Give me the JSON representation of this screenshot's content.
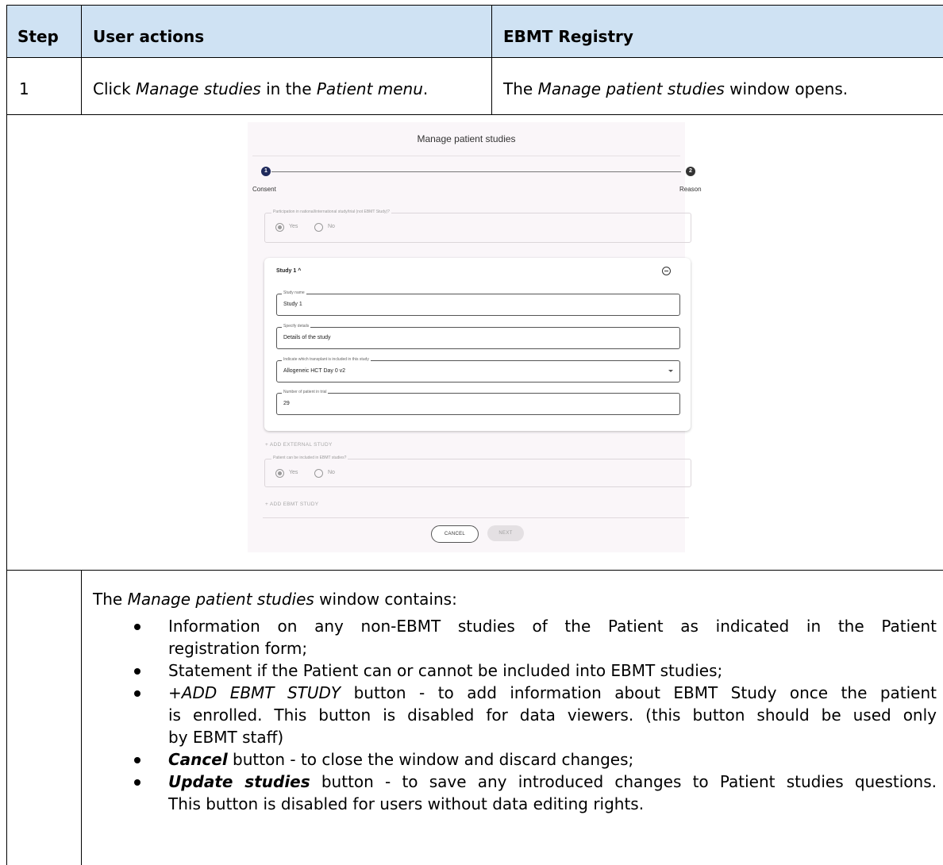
{
  "table": {
    "headers": [
      "Step",
      "User actions",
      "EBMT Registry"
    ],
    "row1": {
      "step": "1",
      "action": {
        "pre": "Click ",
        "em1": "Manage studies",
        "mid": " in the ",
        "em2": "Patient menu",
        "post": "."
      },
      "registry": {
        "pre": "The ",
        "em": "Manage patient studies",
        "post": " window opens."
      }
    }
  },
  "screenshot": {
    "title": "Manage patient studies",
    "steps": [
      {
        "num": "1",
        "label": "Consent"
      },
      {
        "num": "2",
        "label": "Reason"
      }
    ],
    "participation_legend": "Participation in national/international study/trial (not EBMT Study)?",
    "radio_yes": "Yes",
    "radio_no": "No",
    "study_card": {
      "title": "Study 1 ^",
      "fields": [
        {
          "label": "Study name",
          "value": "Study 1"
        },
        {
          "label": "Specify details",
          "value": "Details of the study"
        },
        {
          "label": "Indicate which transplant is included in this study",
          "value": "Allogeneic HCT Day 0 v2"
        },
        {
          "label": "Number of patient in trial",
          "value": "29"
        }
      ]
    },
    "add_external": "+ ADD EXTERNAL STUDY",
    "ebmt_legend": "Patient can be included in EBMT studies?",
    "add_ebmt": "+ ADD EBMT STUDY",
    "cancel": "CANCEL",
    "next": "NEXT"
  },
  "description": {
    "intro": {
      "pre": "The ",
      "em": "Manage patient studies",
      "post": " window contains:"
    },
    "b1": {
      "line1": "Information on any non-EBMT studies of the Patient as indicated in the Patient",
      "line2": "registration form;"
    },
    "b2": {
      "line1": "Statement if the Patient can or cannot be included into EBMT studies;"
    },
    "b3": {
      "em": "+ADD EBMT STUDY",
      "line1_rest": " button - to add information about EBMT Study once the patient",
      "line2": "is enrolled. This button is disabled for data viewers. (this button should be used only",
      "line3": "by EBMT staff)"
    },
    "b4": {
      "strong": "Cancel",
      "rest": " button - to close the window and discard changes;"
    },
    "b5": {
      "strong": "Update studies",
      "line1_rest": " button - to save any introduced changes to Patient studies questions.",
      "line2": "This button is disabled for users without data editing rights."
    }
  }
}
